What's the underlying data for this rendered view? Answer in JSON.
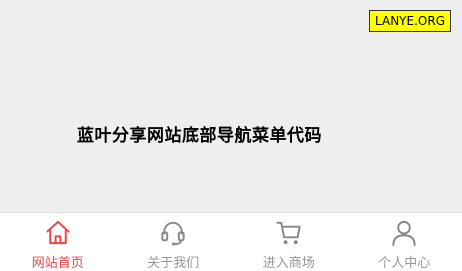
{
  "badge": {
    "text": "LANYE.ORG"
  },
  "main": {
    "headline": "蓝叶分享网站底部导航菜单代码"
  },
  "tabbar": {
    "active_color": "#e84545",
    "inactive_color": "#999999",
    "items": [
      {
        "label": "网站首页",
        "icon": "home-icon",
        "active": true
      },
      {
        "label": "关于我们",
        "icon": "headset-icon",
        "active": false
      },
      {
        "label": "进入商场",
        "icon": "cart-icon",
        "active": false
      },
      {
        "label": "个人中心",
        "icon": "user-icon",
        "active": false
      }
    ]
  }
}
